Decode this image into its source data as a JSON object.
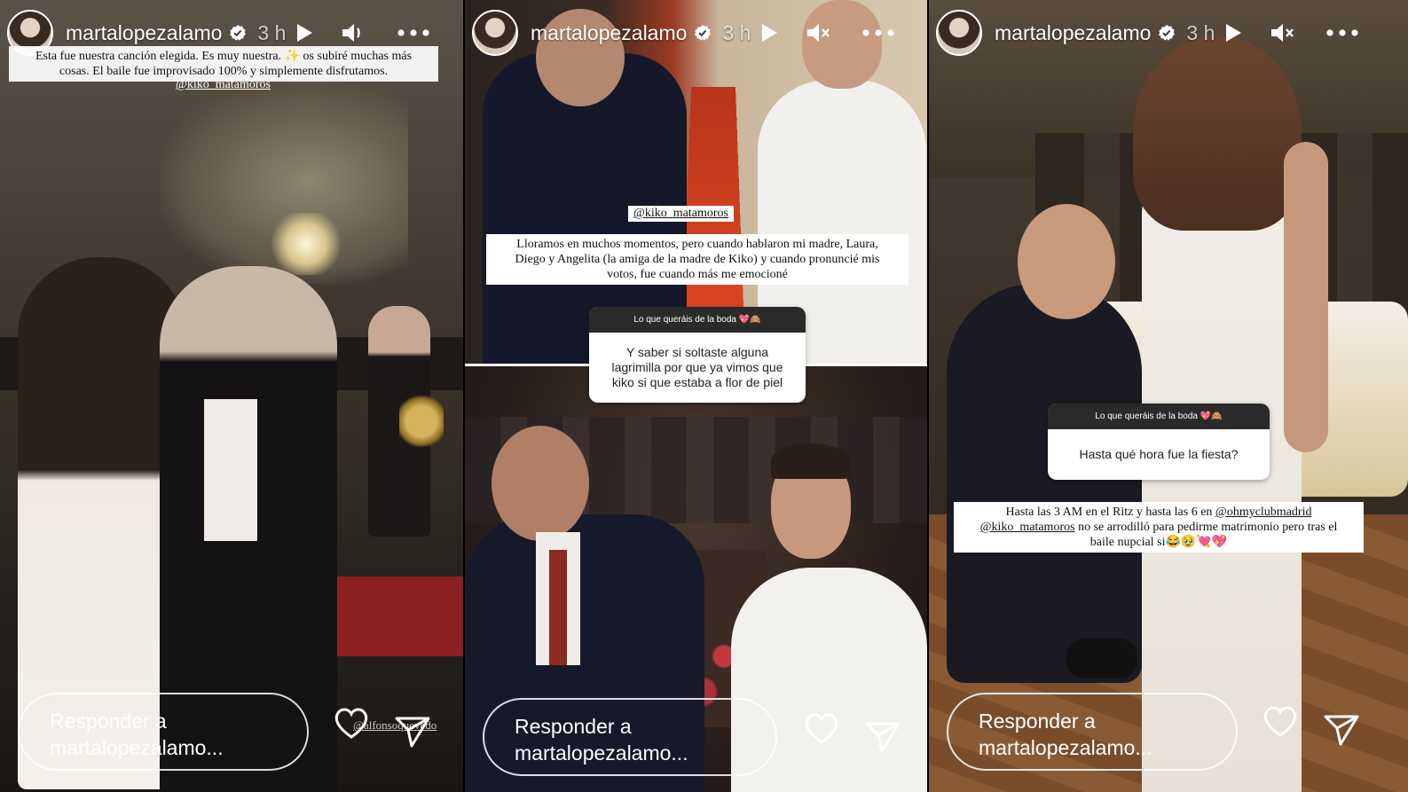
{
  "stories": [
    {
      "username": "martalopezalamo",
      "time": "3 h",
      "sound": "on",
      "caption_lines": [
        "Esta fue nuestra canción elegida. Es muy nuestra. ✨ os subiré muchas más",
        "cosas. El baile fue improvisado 100% y simplemente disfrutamos."
      ],
      "mention": "@kiko_matamoros",
      "photo_credit": "@alfonsoquevedo",
      "reply_line1": "Responder a",
      "reply_line2": "martalopezalamo..."
    },
    {
      "username": "martalopezalamo",
      "time": "3 h",
      "sound": "muted",
      "mention": "@kiko_matamoros",
      "caption_lines": [
        "Lloramos en muchos momentos, pero cuando hablaron mi madre, Laura,",
        "Diego y Angelita (la amiga de la madre de Kiko) y cuando pronuncié mis",
        "votos, fue cuando más me emocioné"
      ],
      "question_header": "Lo que queráis de la boda 💖🙈",
      "question_lines": [
        "Y saber si soltaste alguna",
        "lagrimilla por que ya vimos que",
        "kiko si que estaba a flor de piel"
      ],
      "reply_line1": "Responder a",
      "reply_line2": "martalopezalamo..."
    },
    {
      "username": "martalopezalamo",
      "time": "3 h",
      "sound": "muted",
      "question_header": "Lo que queráis de la boda 💖🙈",
      "question_text": "Hasta qué hora fue la fiesta?",
      "answer_line1_a": "Hasta las 3 AM en el Ritz y hasta las 6 en ",
      "answer_line1_b": "@ohmyclubmadrid",
      "answer_line2_a": "@kiko_matamoros",
      "answer_line2_b": " no se arrodilló para pedirme matrimonio pero tras el",
      "answer_line3": "baile nupcial si😂🥹💘💖",
      "reply_line1": "Responder a",
      "reply_line2": "martalopezalamo..."
    }
  ],
  "colors": {
    "verified": "#ffffff",
    "caption_bg": "#ffffff",
    "question_header_bg": "#2a2a2a"
  }
}
